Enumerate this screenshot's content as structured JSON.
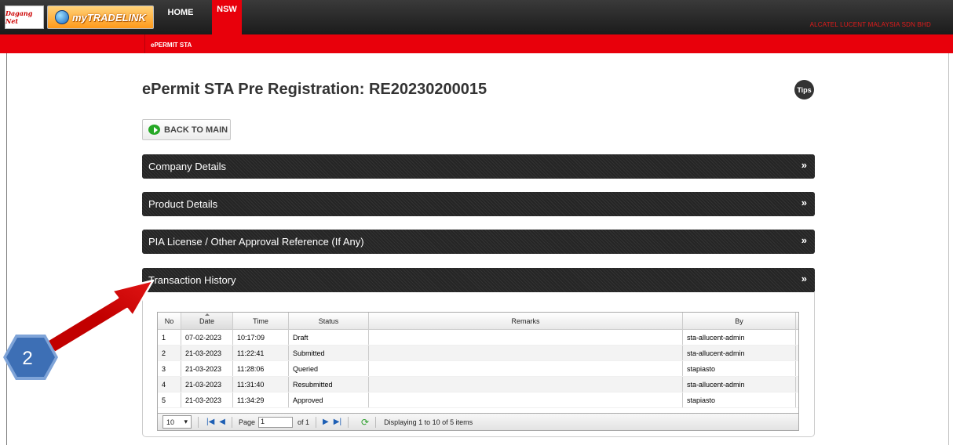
{
  "topbar": {
    "logo1_text": "Dagang Net",
    "logo2_text": "myTRADELINK",
    "nav_home": "HOME",
    "nav_nsw": "NSW",
    "company": "ALCATEL LUCENT MALAYSIA SDN BHD"
  },
  "subnav": {
    "item": "ePERMIT STA"
  },
  "page": {
    "title": "ePermit STA Pre Registration: RE20230200015",
    "tips": "Tips",
    "back_label": "BACK TO MAIN"
  },
  "panels": [
    {
      "label": "Company Details"
    },
    {
      "label": "Product Details"
    },
    {
      "label": "PIA License / Other Approval Reference (If Any)"
    },
    {
      "label": "Transaction History"
    }
  ],
  "table": {
    "headers": {
      "no": "No",
      "date": "Date",
      "time": "Time",
      "status": "Status",
      "remarks": "Remarks",
      "by": "By"
    },
    "rows": [
      {
        "no": "1",
        "date": "07-02-2023",
        "time": "10:17:09",
        "status": "Draft",
        "remarks": "",
        "by": "sta-allucent-admin"
      },
      {
        "no": "2",
        "date": "21-03-2023",
        "time": "11:22:41",
        "status": "Submitted",
        "remarks": "",
        "by": "sta-allucent-admin"
      },
      {
        "no": "3",
        "date": "21-03-2023",
        "time": "11:28:06",
        "status": "Queried",
        "remarks": "",
        "by": "stapiasto"
      },
      {
        "no": "4",
        "date": "21-03-2023",
        "time": "11:31:40",
        "status": "Resubmitted",
        "remarks": "",
        "by": "sta-allucent-admin"
      },
      {
        "no": "5",
        "date": "21-03-2023",
        "time": "11:34:29",
        "status": "Approved",
        "remarks": "",
        "by": "stapiasto"
      }
    ]
  },
  "pager": {
    "page_size": "10",
    "page_label": "Page",
    "page_value": "1",
    "of_label": "of 1",
    "summary": "Displaying 1 to 10 of 5 items"
  },
  "annotation": {
    "badge": "2"
  },
  "colors": {
    "brand_red": "#e8000b",
    "panel_dark": "#2a2a2a",
    "arrow_red": "#e81414",
    "badge_blue": "#3d6fb5"
  }
}
